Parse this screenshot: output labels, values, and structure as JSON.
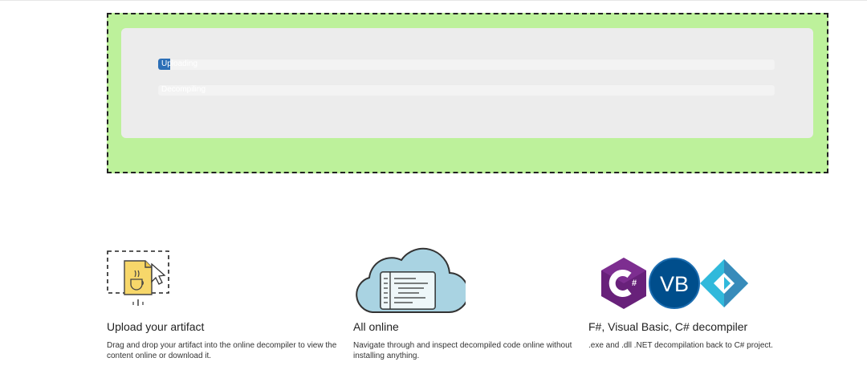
{
  "upload": {
    "progress_bars": [
      {
        "label": "Uploading",
        "value": 0.02,
        "fill_color": "#2c6fb7"
      },
      {
        "label": "Decompiling",
        "value": 0,
        "fill_color": "#2c6fb7"
      }
    ],
    "dropzone_color": "#bdf19b"
  },
  "features": [
    {
      "title": "Upload your artifact",
      "description": "Drag and drop your artifact into the online decompiler to view the content online or download it.",
      "icon": "upload-jar-icon"
    },
    {
      "title": "All online",
      "description": "Navigate through and inspect decompiled code online without installing anything.",
      "icon": "cloud-code-icon"
    },
    {
      "title": "F#, Visual Basic, C# decompiler",
      "description": ".exe and .dll .NET decompilation back to C# project.",
      "icons": [
        "csharp-logo-icon",
        "vb-logo-icon",
        "fsharp-logo-icon"
      ],
      "logo_text": {
        "csharp": "#",
        "vb": "VB"
      }
    }
  ]
}
